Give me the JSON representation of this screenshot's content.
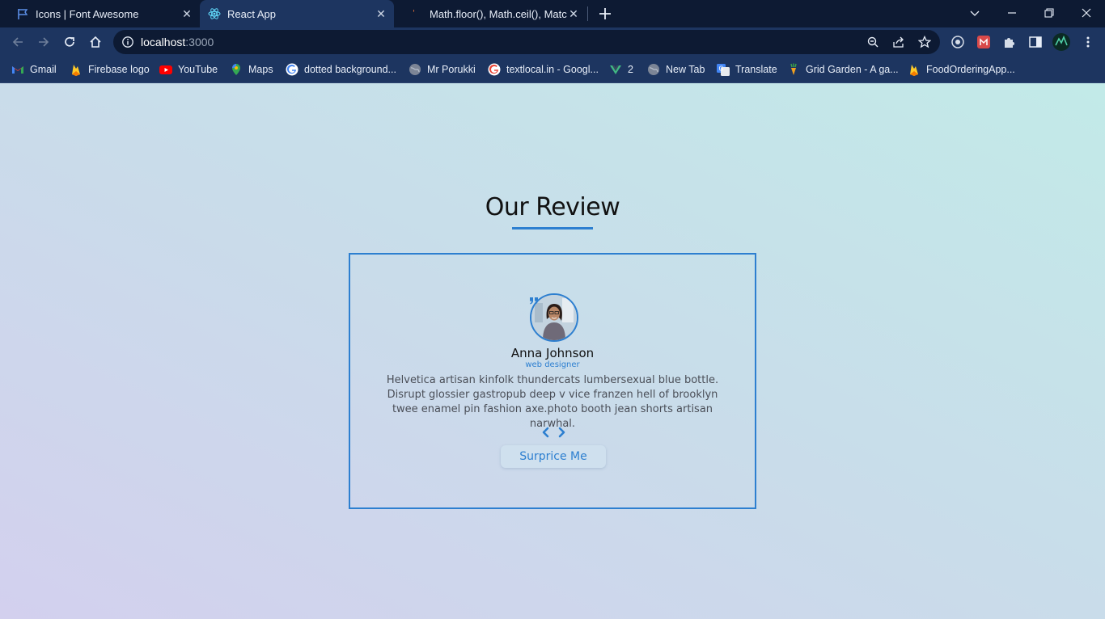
{
  "browser": {
    "tabs": [
      {
        "title": "Icons | Font Awesome",
        "icon": "flag-icon",
        "active": false
      },
      {
        "title": "React App",
        "icon": "react-icon",
        "active": true
      },
      {
        "title": "Math.floor(), Math.ceil(), Match.tr",
        "icon": "script-icon",
        "active": false
      }
    ],
    "new_tab_icon": "plus-icon",
    "address": {
      "host": "localhost",
      "port": ":3000"
    },
    "bookmarks": [
      {
        "label": "Gmail",
        "icon": "gmail-icon"
      },
      {
        "label": "Firebase logo",
        "icon": "firebase-icon"
      },
      {
        "label": "YouTube",
        "icon": "youtube-icon"
      },
      {
        "label": "Maps",
        "icon": "maps-icon"
      },
      {
        "label": "dotted background...",
        "icon": "google-icon"
      },
      {
        "label": "Mr Porukki",
        "icon": "globe-icon"
      },
      {
        "label": "textlocal.in - Googl...",
        "icon": "google-icon"
      },
      {
        "label": "2",
        "icon": "vue-icon"
      },
      {
        "label": "New Tab",
        "icon": "globe-icon"
      },
      {
        "label": "Translate",
        "icon": "translate-icon"
      },
      {
        "label": "Grid Garden - A ga...",
        "icon": "carrot-icon"
      },
      {
        "label": "FoodOrderingApp...",
        "icon": "firebase-icon"
      }
    ]
  },
  "page": {
    "heading": "Our Review",
    "review": {
      "name": "Anna Johnson",
      "job": "web designer",
      "text": "Helvetica artisan kinfolk thundercats lumbersexual blue bottle. Disrupt glossier gastropub deep v vice franzen hell of brooklyn twee enamel pin fashion axe.photo booth jean shorts artisan narwhal.",
      "button": "Surprice Me"
    },
    "accent_color": "#2d7fd0"
  }
}
